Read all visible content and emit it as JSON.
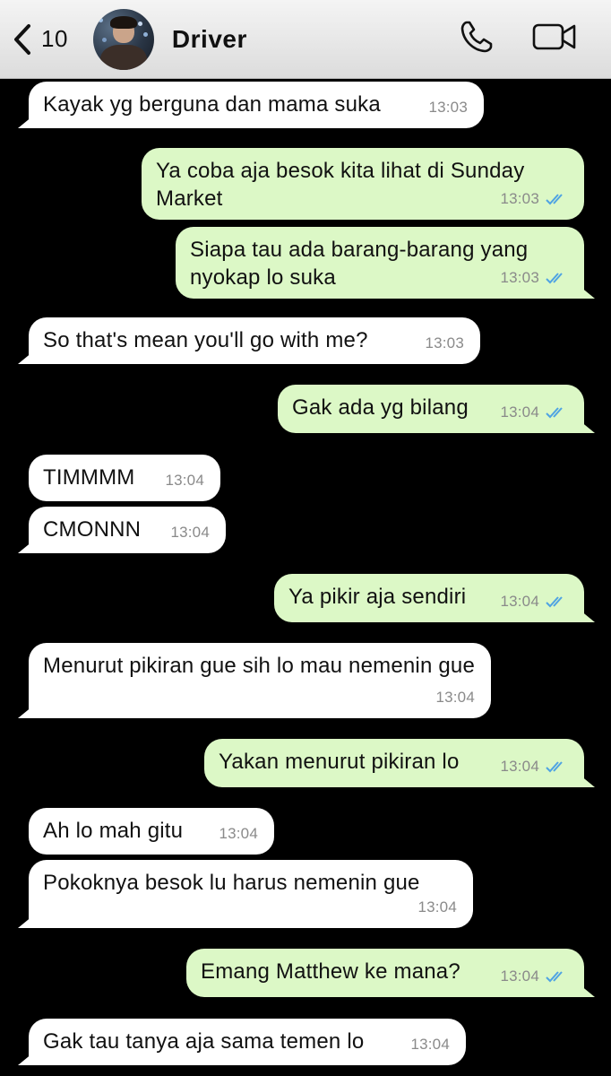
{
  "header": {
    "back_count": "10",
    "contact_name": "Driver"
  },
  "colors": {
    "incoming_bubble": "#ffffff",
    "outgoing_bubble": "#dcf8c6",
    "read_ticks": "#4fa3e3",
    "background": "#000000"
  },
  "messages": [
    {
      "direction": "in",
      "text": "Kayak yg berguna dan mama suka",
      "time": "13:03"
    },
    {
      "direction": "out",
      "text": "Ya coba aja besok kita lihat di Sunday Market",
      "time": "13:03",
      "status": "read"
    },
    {
      "direction": "out",
      "text": "Siapa tau ada barang-barang yang nyokap lo suka",
      "time": "13:03",
      "status": "read"
    },
    {
      "direction": "in",
      "text": "So that's mean you'll go with me?",
      "time": "13:03"
    },
    {
      "direction": "out",
      "text": "Gak ada yg bilang",
      "time": "13:04",
      "status": "read"
    },
    {
      "direction": "in",
      "text": "TIMMMM",
      "time": "13:04"
    },
    {
      "direction": "in",
      "text": "CMONNN",
      "time": "13:04"
    },
    {
      "direction": "out",
      "text": "Ya pikir aja sendiri",
      "time": "13:04",
      "status": "read"
    },
    {
      "direction": "in",
      "text": "Menurut pikiran gue sih lo mau nemenin gue",
      "time": "13:04"
    },
    {
      "direction": "out",
      "text": "Yakan menurut pikiran lo",
      "time": "13:04",
      "status": "read"
    },
    {
      "direction": "in",
      "text": "Ah lo mah gitu",
      "time": "13:04"
    },
    {
      "direction": "in",
      "text": "Pokoknya besok lu harus nemenin gue",
      "time": "13:04"
    },
    {
      "direction": "out",
      "text": "Emang Matthew ke mana?",
      "time": "13:04",
      "status": "read"
    },
    {
      "direction": "in",
      "text": "Gak tau tanya aja sama temen lo",
      "time": "13:04"
    }
  ]
}
